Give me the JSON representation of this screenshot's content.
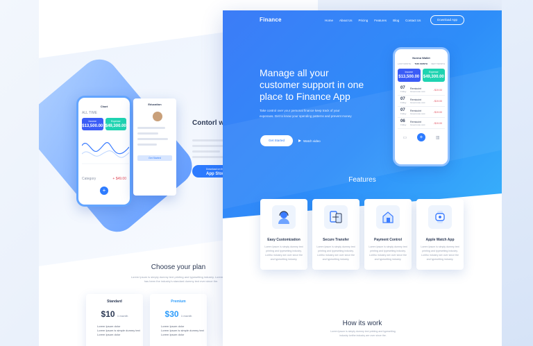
{
  "back_page": {
    "section_title": "Contorl wit",
    "app_store": {
      "small": "Download on the",
      "label": "App Store"
    },
    "chart_phone": {
      "title": "Chart",
      "filter": "ALL TIME",
      "tiles": [
        {
          "label": "Income",
          "value": "$13,500.00"
        },
        {
          "label": "Expense",
          "value": "$49,300.00"
        }
      ],
      "category_label": "Category",
      "category_value": "+ $49.00"
    },
    "profile_phone": {
      "title": "Education",
      "button": "Get Started"
    },
    "choose_title": "Choose your plan",
    "choose_sub": "Lorem Ipsum is simply dummy text printing and typesetting industry. Lorem Ipsum has been the industry's standard dummy text ever since the.",
    "plans": [
      {
        "name": "Standard",
        "price": "$10",
        "per": "1 month",
        "features": [
          "Lorem Ipsum dolor",
          "Lorem Ipsum is simple dummy text",
          "Lorem Ipsum dolor"
        ]
      },
      {
        "name": "Premium",
        "price": "$30",
        "per": "1 month",
        "features": [
          "Lorem Ipsum dolor",
          "Lorem Ipsum is simple dummy text",
          "Lorem Ipsum dolor"
        ]
      }
    ]
  },
  "front_page": {
    "logo": "Finance",
    "nav": [
      "Home",
      "About Us",
      "Pricing",
      "Features",
      "Blog",
      "Contact Us"
    ],
    "download_button": "Download App",
    "headline": "Manage all your customer support in one place to Finance App",
    "description": "Take control over your personal finance keep track of your expenses. Get to know your spending patterns and prevent money",
    "get_started": "Get Started",
    "watch_video": "Watch video",
    "phone": {
      "user": "Norma Wallet",
      "tabs": [
        "LAST MONTH",
        "THIS MONTH",
        "NEXT MONTH"
      ],
      "tiles": [
        {
          "label": "Income",
          "value": "$13,500.00"
        },
        {
          "label": "Expense",
          "value": "$49,300.00"
        }
      ],
      "transactions": [
        {
          "day": "07",
          "sub": "Friday",
          "name": "Remicoint",
          "note": "Greenroute cost",
          "amount": "- $19.00"
        },
        {
          "day": "07",
          "sub": "Friday",
          "name": "Remicoint",
          "note": "Greenroute cost",
          "amount": "- $19.00"
        },
        {
          "day": "07",
          "sub": "Friday",
          "name": "Remicoint",
          "note": "Greenroute cost",
          "amount": "- $19.00"
        },
        {
          "day": "06",
          "sub": "Friday",
          "name": "Remicoint",
          "note": "Greenroute cost",
          "amount": "- $19.00"
        }
      ]
    },
    "features_title": "Features",
    "features": [
      {
        "title": "Easy Customization",
        "icon": "support-agent-icon",
        "text": "Lorem Ipsum is simply dummy text printing and typesetting industry. Loritho industry are over since the and typesetting industry."
      },
      {
        "title": "Secure Transfer",
        "icon": "transfer-icon",
        "text": "Lorem Ipsum is simply dummy text printing and typesetting industry. Loritho industry are over since the and typesetting industry."
      },
      {
        "title": "Payment Control",
        "icon": "payment-icon",
        "text": "Lorem Ipsum is simply dummy text printing and typesetting industry. Loritho industry are over since the and typesetting industry."
      },
      {
        "title": "Apple Watch App",
        "icon": "watch-icon",
        "text": "Lorem Ipsum is simply dummy text printing and typesetting industry. Loritho industry are over since the and typesetting industry."
      }
    ],
    "how_title": "How its work",
    "how_sub": "Lorem Ipsum is simply dummy text printing and typesetting industry lorithe industry are over since the."
  },
  "colors": {
    "brand_blue": "#2f7cf5",
    "income_tile": "#3b5cf6",
    "expense_tile": "#1fd3b1",
    "expense_red": "#e04a5a"
  }
}
